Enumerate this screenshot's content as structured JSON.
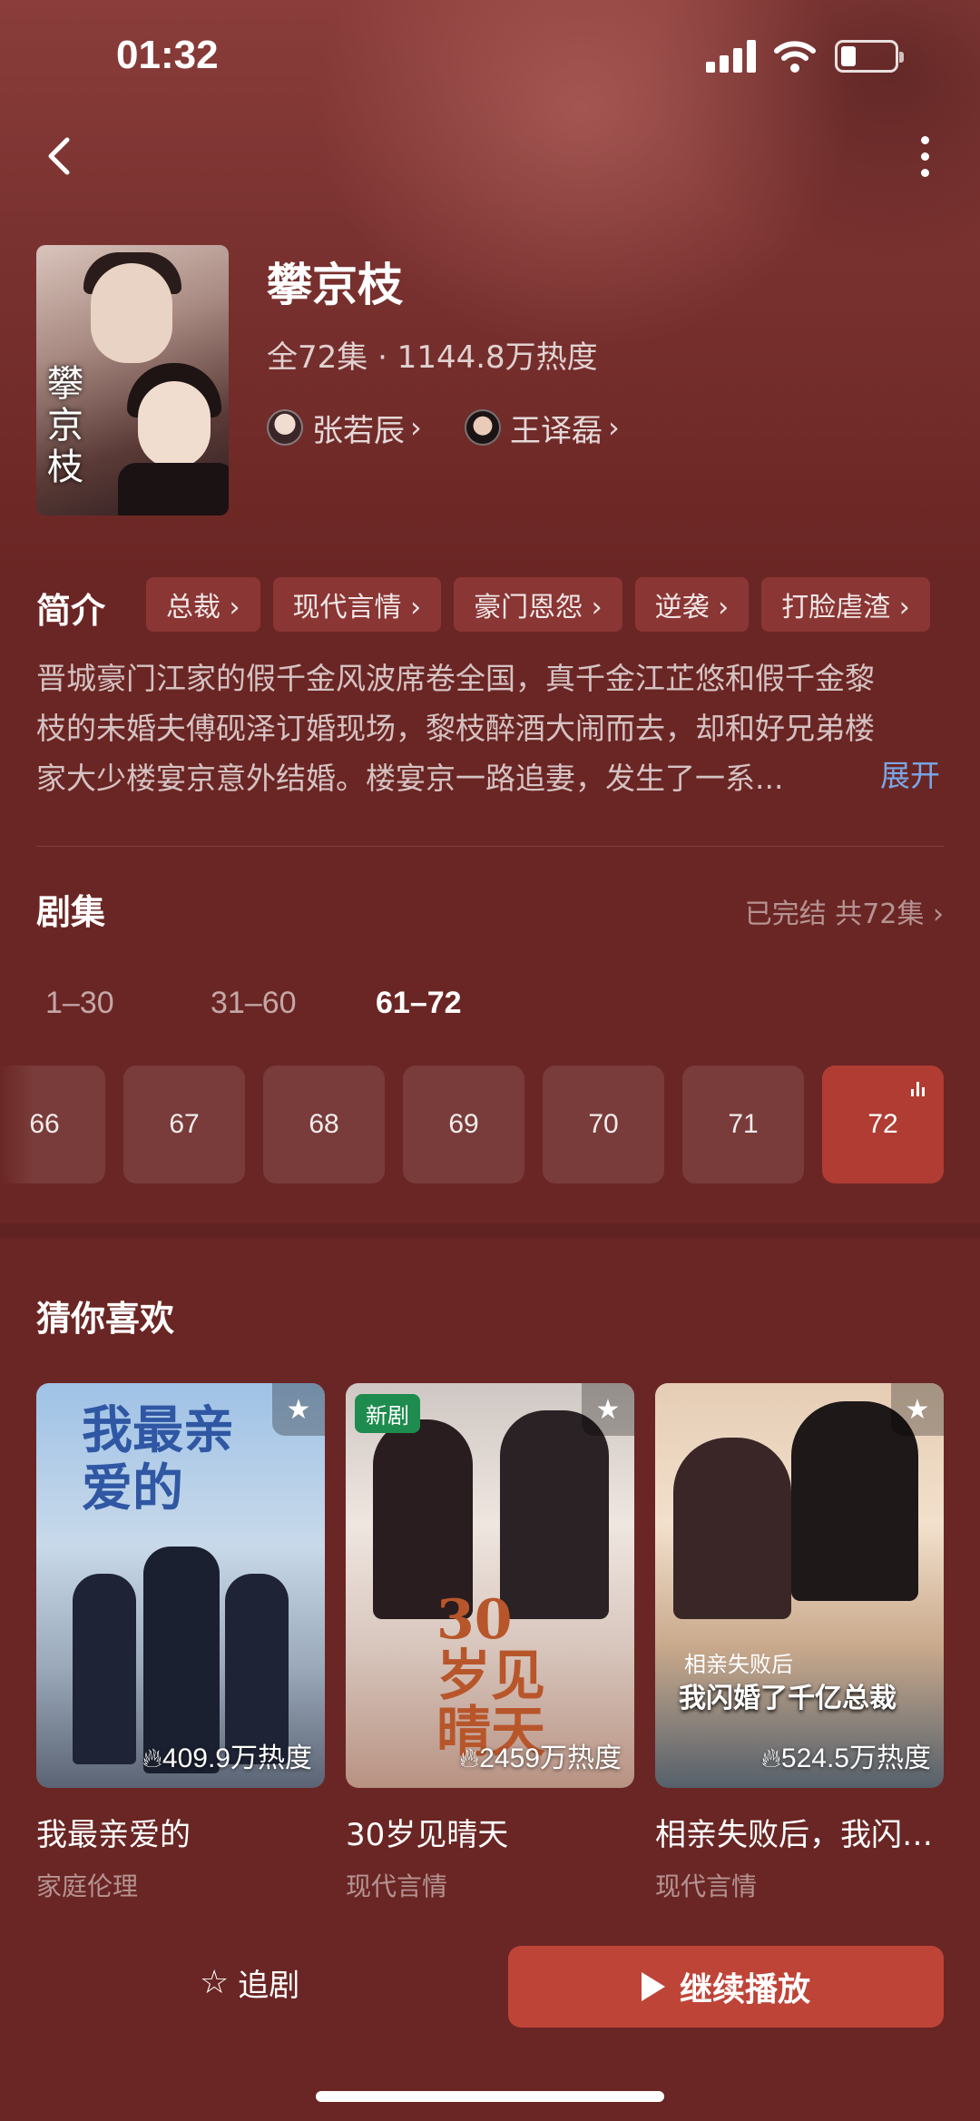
{
  "status_bar": {
    "time": "01:32"
  },
  "drama": {
    "title": "攀京枝",
    "poster_calligraphy": "攀京枝",
    "meta": "全72集 · 1144.8万热度",
    "actors": [
      {
        "name": "张若辰"
      },
      {
        "name": "王译磊"
      }
    ]
  },
  "intro": {
    "label": "简介",
    "tags": [
      "总裁 ›",
      "现代言情 ›",
      "豪门恩怨 ›",
      "逆袭 ›",
      "打脸虐渣 ›"
    ],
    "lines": [
      "晋城豪门江家的假千金风波席卷全国，真千金江芷悠和假千金黎",
      "枝的未婚夫傅砚泽订婚现场，黎枝醉酒大闹而去，却和好兄弟楼",
      "家大少楼宴京意外结婚。楼宴京一路追妻，发生了一系..."
    ],
    "expand": "展开"
  },
  "episodes": {
    "label": "剧集",
    "status": "已完结 共72集 ›",
    "ranges": [
      "1–30",
      "31–60",
      "61–72"
    ],
    "active_range": 2,
    "items": [
      "66",
      "67",
      "68",
      "69",
      "70",
      "71",
      "72"
    ],
    "playing": "72"
  },
  "recommend": {
    "label": "猜你喜欢",
    "cards": [
      {
        "title": "我最亲爱的",
        "genre": "家庭伦理",
        "heat": "409.9万热度",
        "poster_text": "我最亲爱的"
      },
      {
        "title": "30岁见晴天",
        "genre": "现代言情",
        "heat": "2459万热度",
        "badge": "新剧",
        "poster_text": "30岁见晴天"
      },
      {
        "title": "相亲失败后，我闪…",
        "genre": "现代言情",
        "heat": "524.5万热度",
        "poster_text": "我闪婚了千亿总裁",
        "poster_subtext": "相亲失败后"
      }
    ]
  },
  "bottom": {
    "follow_label": "追剧",
    "play_label": "继续播放"
  },
  "icons": {
    "back": "chevron-left-icon",
    "more": "more-vertical-icon",
    "star": "star-icon",
    "play": "play-icon",
    "heat": "flame-icon"
  },
  "colors": {
    "background": "#6a2624",
    "accent": "#bf4438",
    "tag_bg": "#8a3634",
    "link": "#7aa7e8",
    "new_badge": "#1e8c4e"
  }
}
